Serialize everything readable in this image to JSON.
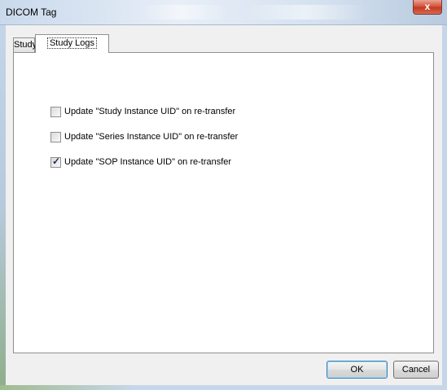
{
  "window": {
    "title": "DICOM Tag",
    "close_glyph": "x"
  },
  "tabs": [
    {
      "label": "Study",
      "selected": false
    },
    {
      "label": "Study Logs",
      "selected": true
    }
  ],
  "options": [
    {
      "label": "Update \"Study Instance UID\" on re-transfer",
      "checked": false
    },
    {
      "label": "Update \"Series Instance UID\" on re-transfer",
      "checked": false
    },
    {
      "label": "Update \"SOP Instance UID\" on re-transfer",
      "checked": true
    }
  ],
  "buttons": {
    "ok_label": "OK",
    "cancel_label": "Cancel"
  },
  "icons": {
    "close": "close-icon",
    "checkmark": "checkmark-icon"
  },
  "colors": {
    "close_button": "#c9452d",
    "titlebar": "#d6e2f0",
    "default_button_border": "#3c7fb1"
  }
}
